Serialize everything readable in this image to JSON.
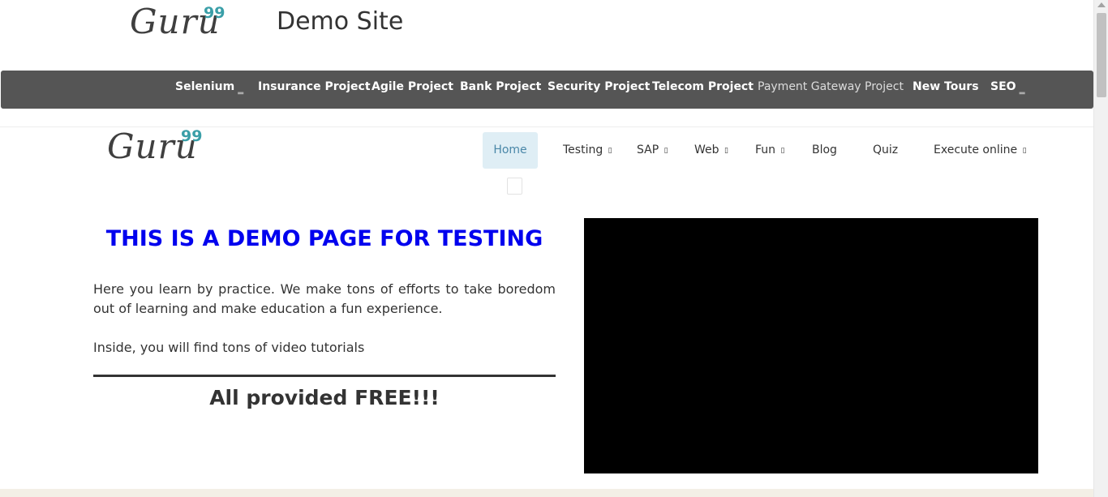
{
  "header": {
    "logo_word": "Guru",
    "logo_sup": "99",
    "site_title": "Demo Site"
  },
  "top_nav": {
    "items": [
      {
        "label": "Selenium",
        "has_dropdown": true
      },
      {
        "label": "Insurance Project"
      },
      {
        "label": "Agile Project"
      },
      {
        "label": "Bank Project"
      },
      {
        "label": "Security Project"
      },
      {
        "label": "Telecom Project"
      },
      {
        "label": "Payment Gateway Project"
      },
      {
        "label": "New Tours"
      },
      {
        "label": "SEO",
        "has_dropdown": true
      }
    ],
    "caret_glyph": "▂"
  },
  "main_nav": {
    "logo_word": "Guru",
    "logo_sup": "99",
    "items": [
      {
        "label": "Home",
        "active": true
      },
      {
        "label": "Testing",
        "suffix": "▯"
      },
      {
        "label": "SAP",
        "suffix": "▯"
      },
      {
        "label": "Web",
        "suffix": "▯"
      },
      {
        "label": "Fun",
        "suffix": "▯"
      },
      {
        "label": "Blog"
      },
      {
        "label": "Quiz"
      },
      {
        "label": "Execute online",
        "suffix": "▯"
      }
    ]
  },
  "content": {
    "headline": "THIS IS A DEMO PAGE FOR TESTING",
    "paragraph1": "Here you learn by practice. We make tons of efforts to take boredom out of learning and make education a fun experience.",
    "paragraph2": "Inside, you will find tons of video tutorials",
    "free_text": "All provided FREE!!!"
  },
  "colors": {
    "nav_bg": "#555555",
    "headline": "#0000ee",
    "logo_accent": "#3a9fa8",
    "active_tab_bg": "#dfeef5"
  }
}
